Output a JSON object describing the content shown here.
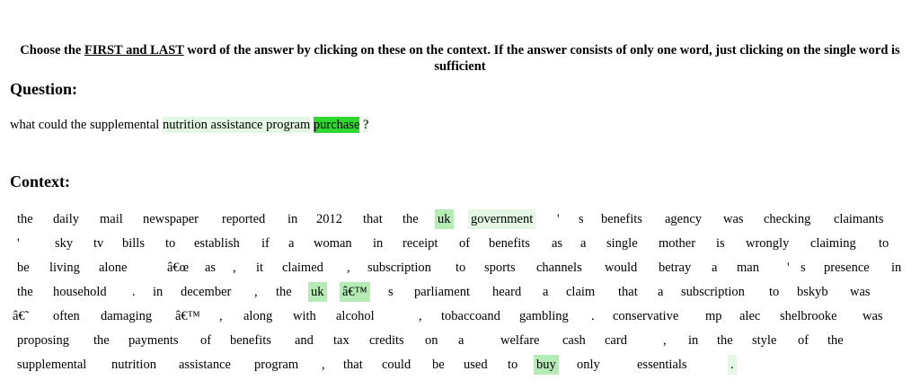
{
  "instructions": {
    "part1": "Choose the ",
    "emphasis": "FIRST and LAST",
    "part2": " word of the answer by clicking on these on the context. If the answer consists of only one word, just clicking on the single word is sufficient"
  },
  "question_heading": "Question:",
  "context_heading": "Context:",
  "question_tokens": [
    {
      "text": "what could the supplemental ",
      "hl": ""
    },
    {
      "text": "nutrition assistance program",
      "hl": "light"
    },
    {
      "text": " ",
      "hl": ""
    },
    {
      "text": "purchase",
      "hl": "strong"
    },
    {
      "text": " ",
      "hl": ""
    },
    {
      "text": "?",
      "hl": "light"
    }
  ],
  "colors": {
    "light": "#e4f6e4",
    "mid": "#b5ecb5",
    "strong": "#2ed82e"
  },
  "context_rows": [
    [
      [
        "the",
        ""
      ],
      [
        "daily",
        ""
      ],
      [
        "mail",
        ""
      ],
      [
        "newspaper",
        ""
      ],
      [
        "reported",
        ""
      ],
      [
        "in",
        ""
      ],
      [
        "2012",
        ""
      ],
      [
        "that",
        ""
      ],
      [
        "the",
        ""
      ],
      [
        "uk",
        "mid"
      ],
      [
        "government",
        "light"
      ],
      [
        "'",
        ""
      ],
      [
        "s",
        ""
      ],
      [
        "benefits",
        ""
      ],
      [
        "agency",
        ""
      ],
      [
        "was",
        ""
      ],
      [
        "checking",
        ""
      ],
      [
        "claimants",
        ""
      ]
    ],
    [
      [
        "'",
        ""
      ],
      [
        "sky",
        ""
      ],
      [
        "tv",
        ""
      ],
      [
        "bills",
        ""
      ],
      [
        "to",
        ""
      ],
      [
        "establish",
        ""
      ],
      [
        "if",
        ""
      ],
      [
        "a",
        ""
      ],
      [
        "woman",
        ""
      ],
      [
        "in",
        ""
      ],
      [
        "receipt",
        ""
      ],
      [
        "of",
        ""
      ],
      [
        "benefits",
        ""
      ],
      [
        "as",
        ""
      ],
      [
        "a",
        ""
      ],
      [
        "single",
        ""
      ],
      [
        "mother",
        ""
      ],
      [
        "is",
        ""
      ],
      [
        "wrongly",
        ""
      ],
      [
        "claiming",
        ""
      ],
      [
        "to",
        ""
      ]
    ],
    [
      [
        "be",
        ""
      ],
      [
        "living",
        ""
      ],
      [
        "alone",
        ""
      ],
      [
        "â€œ",
        ""
      ],
      [
        "as",
        ""
      ],
      [
        ",",
        ""
      ],
      [
        "it",
        ""
      ],
      [
        "claimed",
        ""
      ],
      [
        ",",
        ""
      ],
      [
        "subscription",
        ""
      ],
      [
        "to",
        ""
      ],
      [
        "sports",
        ""
      ],
      [
        "channels",
        ""
      ],
      [
        "would",
        ""
      ],
      [
        "betray",
        ""
      ],
      [
        "a",
        ""
      ],
      [
        "man",
        ""
      ],
      [
        "'",
        ""
      ],
      [
        "s",
        ""
      ],
      [
        "presence",
        ""
      ],
      [
        "in",
        ""
      ]
    ],
    [
      [
        "the",
        ""
      ],
      [
        "household",
        ""
      ],
      [
        ".",
        ""
      ],
      [
        "in",
        ""
      ],
      [
        "december",
        ""
      ],
      [
        ",",
        ""
      ],
      [
        "the",
        ""
      ],
      [
        "uk",
        "mid"
      ],
      [
        "â€™",
        "mid"
      ],
      [
        "s",
        ""
      ],
      [
        "parliament",
        ""
      ],
      [
        "heard",
        ""
      ],
      [
        "a",
        ""
      ],
      [
        "claim",
        ""
      ],
      [
        "that",
        ""
      ],
      [
        "a",
        ""
      ],
      [
        "subscription",
        ""
      ],
      [
        "to",
        ""
      ],
      [
        "bskyb",
        ""
      ],
      [
        "was",
        ""
      ]
    ],
    [
      [
        "â€˜",
        ""
      ],
      [
        "often",
        ""
      ],
      [
        "damaging",
        ""
      ],
      [
        "â€™",
        ""
      ],
      [
        ",",
        ""
      ],
      [
        "along",
        ""
      ],
      [
        "with",
        ""
      ],
      [
        "alcohol",
        ""
      ],
      [
        ",",
        ""
      ],
      [
        "tobacco",
        ""
      ],
      [
        "and",
        ""
      ],
      [
        "gambling",
        ""
      ],
      [
        ".",
        ""
      ],
      [
        "conservative",
        ""
      ],
      [
        "mp",
        ""
      ],
      [
        "alec",
        ""
      ],
      [
        "shelbrooke",
        ""
      ],
      [
        "was",
        ""
      ]
    ],
    [
      [
        "proposing",
        ""
      ],
      [
        "the",
        ""
      ],
      [
        "payments",
        ""
      ],
      [
        "of",
        ""
      ],
      [
        "benefits",
        ""
      ],
      [
        "and",
        ""
      ],
      [
        "tax",
        ""
      ],
      [
        "credits",
        ""
      ],
      [
        "on",
        ""
      ],
      [
        "a",
        ""
      ],
      [
        "welfare",
        ""
      ],
      [
        "cash",
        ""
      ],
      [
        "card",
        ""
      ],
      [
        ",",
        ""
      ],
      [
        "in",
        ""
      ],
      [
        "the",
        ""
      ],
      [
        "style",
        ""
      ],
      [
        "of",
        ""
      ],
      [
        "the",
        ""
      ]
    ],
    [
      [
        "supplemental",
        ""
      ],
      [
        "nutrition",
        ""
      ],
      [
        "assistance",
        ""
      ],
      [
        "program",
        ""
      ],
      [
        ",",
        ""
      ],
      [
        "that",
        ""
      ],
      [
        "could",
        ""
      ],
      [
        "be",
        ""
      ],
      [
        "used",
        ""
      ],
      [
        "to",
        ""
      ],
      [
        "buy",
        "mid"
      ],
      [
        "only",
        ""
      ],
      [
        "essentials",
        ""
      ],
      [
        ".",
        "light"
      ]
    ]
  ]
}
